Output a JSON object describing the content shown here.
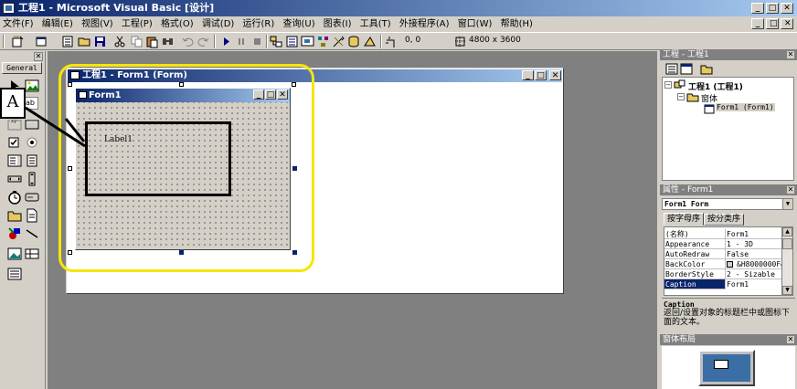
{
  "window": {
    "title": "工程1 - Microsoft Visual Basic [设计]"
  },
  "menu": [
    "文件(F)",
    "编辑(E)",
    "视图(V)",
    "工程(P)",
    "格式(O)",
    "调试(D)",
    "运行(R)",
    "查询(U)",
    "图表(I)",
    "工具(T)",
    "外接程序(A)",
    "窗口(W)",
    "帮助(H)"
  ],
  "toolbar": {
    "position": "0, 0",
    "size": "4800 x 3600"
  },
  "toolbox": {
    "tab": "General",
    "label_tool_letter": "A",
    "textbox_tool_text": "ab"
  },
  "form_window": {
    "title": "工程1 - Form1 (Form)"
  },
  "form1": {
    "title": "Form1",
    "label": "Label1"
  },
  "project_panel": {
    "title": "工程 - 工程1",
    "project": "工程1 (工程1)",
    "folder": "窗体",
    "form": "Form1 (Form1)"
  },
  "properties_panel": {
    "title": "属性 - Form1",
    "object_select": "Form1 Form",
    "tab_alpha": "按字母序",
    "tab_category": "按分类序",
    "rows": [
      {
        "key": "(名称)",
        "value": "Form1"
      },
      {
        "key": "Appearance",
        "value": "1 - 3D"
      },
      {
        "key": "AutoRedraw",
        "value": "False"
      },
      {
        "key": "BackColor",
        "value": "&H8000000F&"
      },
      {
        "key": "BorderStyle",
        "value": "2 - Sizable"
      },
      {
        "key": "Caption",
        "value": "Form1"
      }
    ],
    "desc_title": "Caption",
    "desc_text": "返回/设置对象的标题栏中或图标下面的文本。"
  },
  "layout_panel": {
    "title": "窗体布局"
  },
  "colors": {
    "highlight": "#ffff00",
    "title_start": "#0a246a",
    "title_end": "#a6caf0",
    "selection": "#0a246a"
  }
}
